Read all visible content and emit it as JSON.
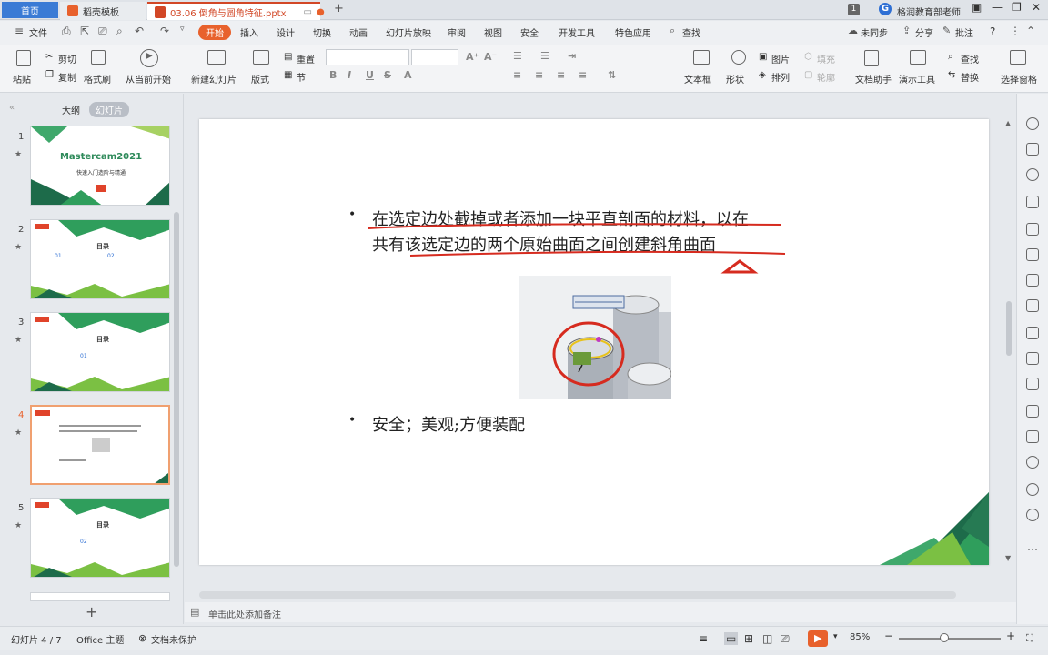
{
  "titlebar": {
    "home_tab": "首页",
    "template_tab": "稻壳模板",
    "doc_tab": "03.06 倒角与圆角特征.pptx",
    "new_tab": "+",
    "badge": "1",
    "account": "格润教育部老师",
    "help": "?"
  },
  "menubar": {
    "file": "文件",
    "tabs": [
      "开始",
      "插入",
      "设计",
      "切换",
      "动画",
      "幻灯片放映",
      "审阅",
      "视图",
      "安全",
      "开发工具",
      "特色应用"
    ],
    "search": "查找",
    "sync": "未同步",
    "share": "分享",
    "comment": "批注"
  },
  "ribbon": {
    "paste": "粘贴",
    "cut": "剪切",
    "copy": "复制",
    "format_painter": "格式刷",
    "from_current": "从当前开始",
    "new_slide": "新建幻灯片",
    "layout": "版式",
    "section": "节",
    "reset": "重置",
    "textbox": "文本框",
    "shape": "形状",
    "picture": "图片",
    "arrange": "排列",
    "fill": "填充",
    "outline": "轮廓",
    "doc_assistant": "文档助手",
    "present_tools": "演示工具",
    "find": "查找",
    "replace": "替换",
    "select_pane": "选择窗格",
    "font_buttons": [
      "B",
      "I",
      "U",
      "S",
      "A"
    ]
  },
  "leftpanel": {
    "outline_tab": "大纲",
    "slides_tab": "幻灯片",
    "slide_numbers": [
      "1",
      "2",
      "3",
      "4",
      "5"
    ],
    "thumb1_title": "Mastercam2021",
    "thumb1_sub": "快速入门造阶与精通",
    "thumb_heading": "目录",
    "thumb2_items": [
      "01",
      "02"
    ],
    "thumb3_items": [
      "01"
    ],
    "thumb5_items": [
      "02"
    ],
    "add": "+"
  },
  "slide": {
    "bullet1_line1": "在选定边处截掉或者添加一块平直剖面的材料，以在",
    "bullet1_line2": "共有该选定边的两个原始曲面之间创建斜角曲面",
    "bullet2": "安全；美观;方便装配",
    "bullet_char": "•"
  },
  "notes": {
    "placeholder": "单击此处添加备注"
  },
  "status": {
    "slide_count": "幻灯片 4 / 7",
    "theme": "Office 主题",
    "protect": "文档未保护",
    "zoom": "85%",
    "zoom_fraction": 0.45
  },
  "colors": {
    "accent": "#e8612c",
    "annotation_red": "#d62b1f",
    "triangle_dark": "#1d6b4a",
    "triangle_mid": "#2f9e5c",
    "triangle_light": "#7bc043"
  }
}
